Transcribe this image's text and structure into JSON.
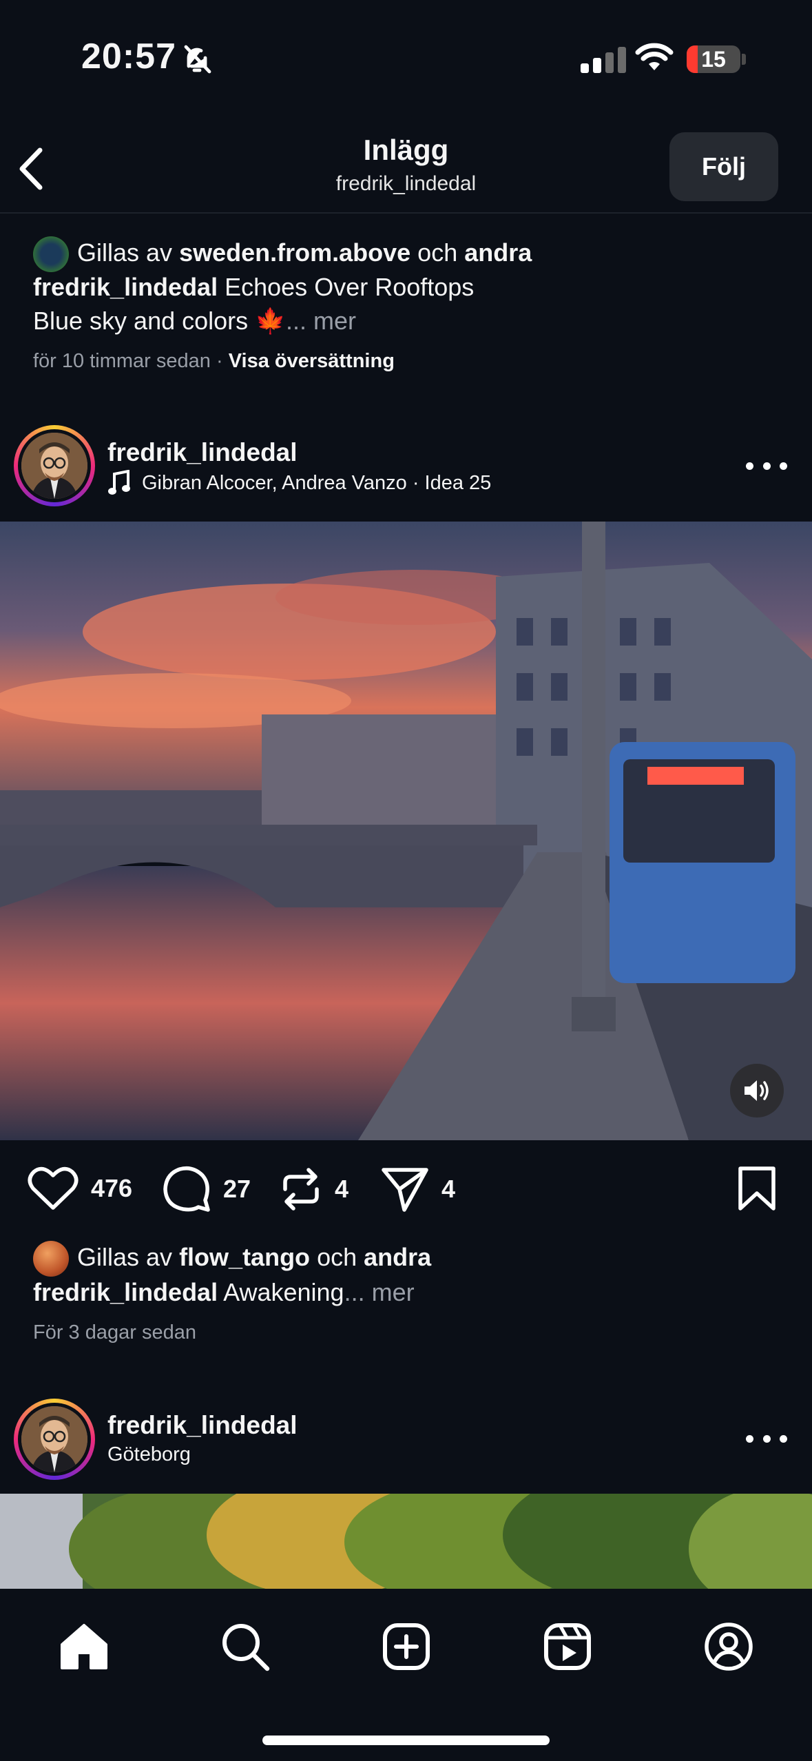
{
  "status_bar": {
    "time": "20:57",
    "battery": "15"
  },
  "header": {
    "title": "Inlägg",
    "subtitle": "fredrik_lindedal",
    "follow_label": "Följ"
  },
  "prev_post": {
    "liked_prefix": "Gillas av",
    "liked_user": "sweden.from.above",
    "liked_and": "och",
    "liked_others": "andra",
    "caption_user": "fredrik_lindedal",
    "caption_line1": "Echoes Over Rooftops",
    "caption_line2": "Blue sky and colors 🍁",
    "more": "... mer",
    "time_ago": "för 10 timmar sedan",
    "separator": "·",
    "translate": "Visa översättning"
  },
  "post": {
    "username": "fredrik_lindedal",
    "music": "Gibran Alcocer, Andrea Vanzo · Idea 25",
    "actions": {
      "likes": "476",
      "comments": "27",
      "reposts": "4",
      "shares": "4"
    },
    "liked_prefix": "Gillas av",
    "liked_user": "flow_tango",
    "liked_and": "och",
    "liked_others": "andra",
    "caption_user": "fredrik_lindedal",
    "caption": "Awakening",
    "more": "... mer",
    "time_ago": "För 3 dagar sedan"
  },
  "next_post": {
    "username": "fredrik_lindedal",
    "location": "Göteborg"
  },
  "nav": [
    "home-icon",
    "search-icon",
    "create-icon",
    "reels-icon",
    "profile-icon"
  ]
}
